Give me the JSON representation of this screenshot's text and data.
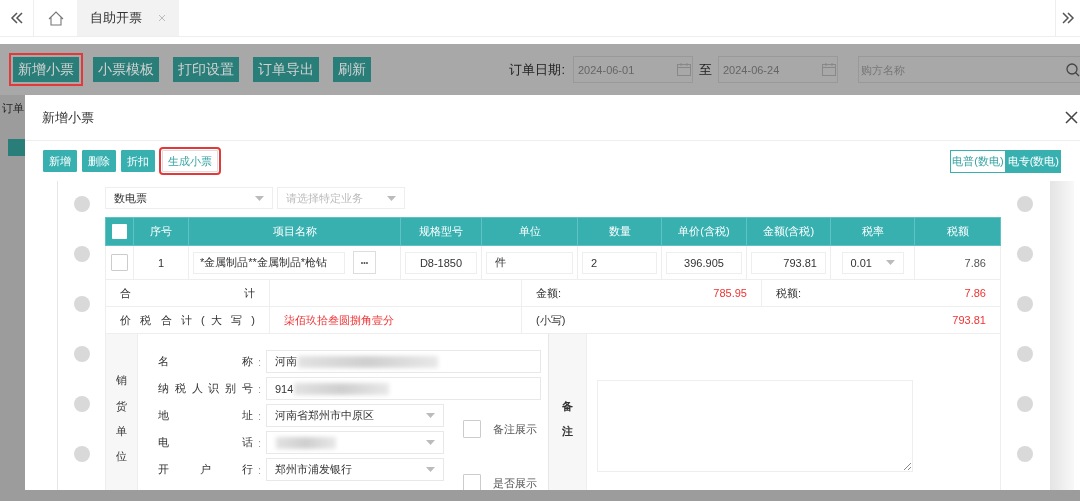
{
  "tabs": [
    {
      "label": "自助开票",
      "selected": true
    }
  ],
  "toolbar": {
    "buttons": [
      {
        "label": "新增小票",
        "highlighted": true
      },
      {
        "label": "小票模板",
        "highlighted": false
      },
      {
        "label": "打印设置",
        "highlighted": false
      },
      {
        "label": "订单导出",
        "highlighted": false
      },
      {
        "label": "刷新",
        "highlighted": false
      }
    ],
    "date_label": "订单日期:",
    "date_from": "2024-06-01",
    "separator": "至",
    "date_to": "2024-06-24",
    "buyer_search": {
      "placeholder": "购方名称"
    }
  },
  "background_text": "订单",
  "modal": {
    "title": "新增小票",
    "buttons": [
      {
        "label": "新增",
        "kind": "solid",
        "highlighted": false
      },
      {
        "label": "删除",
        "kind": "solid",
        "highlighted": false
      },
      {
        "label": "折扣",
        "kind": "solid",
        "highlighted": false
      },
      {
        "label": "生成小票",
        "kind": "outline",
        "highlighted": true
      }
    ],
    "invoice_types": [
      {
        "label": "电普(数电)",
        "selected": false
      },
      {
        "label": "电专(数电)",
        "selected": true
      }
    ],
    "invoice": {
      "type_select": "数电票",
      "business_select": {
        "placeholder": "请选择特定业务"
      },
      "header_checked": false,
      "columns": [
        "序号",
        "项目名称",
        "规格型号",
        "单位",
        "数量",
        "单价(含税)",
        "金额(含税)",
        "税率",
        "税额"
      ],
      "rows": [
        {
          "checked": false,
          "index": "1",
          "name": "*金属制品**金属制品*枪钻",
          "more": "•••",
          "spec": "D8-1850",
          "unit": "件",
          "quantity": "2",
          "unit_price": "396.905",
          "amount": "793.81",
          "tax_rate": "0.01",
          "tax": "7.86"
        }
      ],
      "total": {
        "label": "合 计",
        "amount_label": "金额:",
        "amount": "785.95",
        "tax_label": "税额:",
        "tax": "7.86"
      },
      "grand_total": {
        "label": "价 税 合 计 ( 大 写 )",
        "in_words": "柒佰玖拾叁圆捌角壹分",
        "figures_label": "(小写)",
        "figures": "793.81"
      },
      "seller": {
        "label": "销货单位",
        "fields": [
          {
            "label": "名 称",
            "colon": ":",
            "value": "河南",
            "kind": "text"
          },
          {
            "label": "纳 税 人 识 别 号",
            "colon": ":",
            "value": "914",
            "kind": "text"
          },
          {
            "label": "地 址",
            "colon": ":",
            "value": "河南省郑州市中原区",
            "kind": "select"
          },
          {
            "label": "电 话",
            "colon": ":",
            "kind": "select"
          },
          {
            "label": "开 户 行",
            "colon": ":",
            "value": "郑州市浦发银行",
            "kind": "select"
          }
        ],
        "options": [
          {
            "label": "备注展示",
            "checked": false
          },
          {
            "label": "是否展示",
            "checked": false
          }
        ]
      },
      "remarks": {
        "label": "备注"
      }
    }
  }
}
